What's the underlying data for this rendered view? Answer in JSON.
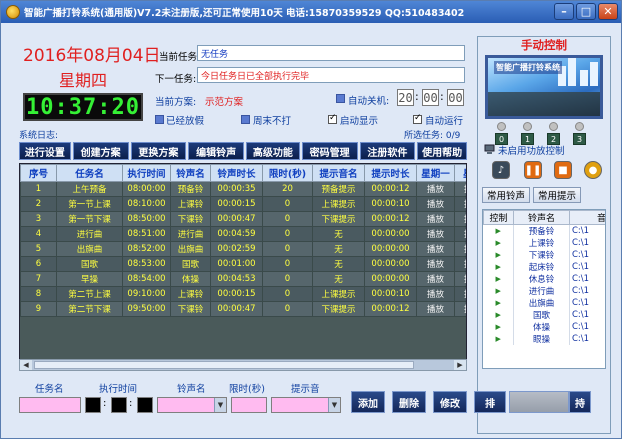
{
  "window": {
    "title": "智能广播打铃系统(通用版)V7.2未注册版,还可正常使用10天 电话:15870359529 QQ:510483402",
    "controls": {
      "minimize": "–",
      "maximize": "□",
      "close": "✕"
    }
  },
  "clock": {
    "date": "2016年08月04日",
    "weekday": "星期四",
    "time": "10:37:20"
  },
  "tasks": {
    "current_label": "当前任务:",
    "current_value": "无任务",
    "next_label": "下一任务:",
    "next_value": "今日任务日已全部执行完毕"
  },
  "plan": {
    "label": "当前方案:",
    "value": "示范方案"
  },
  "auto_shutdown": {
    "label": "自动关机:",
    "hh": "20",
    "mm": "00",
    "ss": "00"
  },
  "options": {
    "holiday": "已经放假",
    "weekend": "周末不打",
    "start_show": "启动显示",
    "auto_run": "自动运行"
  },
  "status": {
    "system_log": "系统日志:",
    "selected_task": "所选任务: 0/9"
  },
  "toolbar": {
    "buttons": [
      "进行设置",
      "创建方案",
      "更换方案",
      "编辑铃声",
      "高级功能",
      "密码管理",
      "注册软件",
      "使用帮助"
    ]
  },
  "grid": {
    "columns": [
      "序号",
      "任务名",
      "执行时间",
      "铃声名",
      "铃声时长",
      "限时(秒)",
      "提示音名",
      "提示时长",
      "星期一",
      "星期"
    ],
    "rows": [
      [
        "1",
        "上午预备",
        "08:00:00",
        "预备铃",
        "00:00:35",
        "20",
        "预备提示",
        "00:00:12",
        "播放",
        "播放"
      ],
      [
        "2",
        "第一节上课",
        "08:10:00",
        "上课铃",
        "00:00:15",
        "0",
        "上课提示",
        "00:00:10",
        "播放",
        "播放"
      ],
      [
        "3",
        "第一节下课",
        "08:50:00",
        "下课铃",
        "00:00:47",
        "0",
        "下课提示",
        "00:00:12",
        "播放",
        "播放"
      ],
      [
        "4",
        "进行曲",
        "08:51:00",
        "进行曲",
        "00:04:59",
        "0",
        "无",
        "00:00:00",
        "播放",
        "播放"
      ],
      [
        "5",
        "出旗曲",
        "08:52:00",
        "出旗曲",
        "00:02:59",
        "0",
        "无",
        "00:00:00",
        "播放",
        "播放"
      ],
      [
        "6",
        "国歌",
        "08:53:00",
        "国歌",
        "00:01:00",
        "0",
        "无",
        "00:00:00",
        "播放",
        "播放"
      ],
      [
        "7",
        "早操",
        "08:54:00",
        "体操",
        "00:04:53",
        "0",
        "无",
        "00:00:00",
        "播放",
        "播放"
      ],
      [
        "8",
        "第二节上课",
        "09:10:00",
        "上课铃",
        "00:00:15",
        "0",
        "上课提示",
        "00:00:10",
        "播放",
        "播放"
      ],
      [
        "9",
        "第二节下课",
        "09:50:00",
        "下课铃",
        "00:00:47",
        "0",
        "下课提示",
        "00:00:12",
        "播放",
        "播放"
      ]
    ]
  },
  "manual": {
    "title": "手动控制",
    "banner_text": "智能广播打铃系统",
    "leds": [
      "0",
      "1",
      "2",
      "3"
    ],
    "power_status": "未启用功放控制",
    "tabs": [
      "常用铃声",
      "常用提示"
    ],
    "list_columns": [
      "控制",
      "铃声名",
      "音"
    ],
    "list_rows": [
      [
        "预备铃",
        "C:\\1"
      ],
      [
        "上课铃",
        "C:\\1"
      ],
      [
        "下课铃",
        "C:\\1"
      ],
      [
        "起床铃",
        "C:\\1"
      ],
      [
        "休息铃",
        "C:\\1"
      ],
      [
        "进行曲",
        "C:\\1"
      ],
      [
        "出旗曲",
        "C:\\1"
      ],
      [
        "国歌",
        "C:\\1"
      ],
      [
        "体操",
        "C:\\1"
      ],
      [
        "眼操",
        "C:\\1"
      ]
    ]
  },
  "editor": {
    "task_name_label": "任务名",
    "exec_time_label": "执行时间",
    "ring_name_label": "铃声名",
    "limit_label": "限时(秒)",
    "hint_label": "提示音",
    "buttons": {
      "add": "添加",
      "delete": "删除",
      "modify": "修改",
      "sort": "排",
      "extra": "持"
    }
  }
}
